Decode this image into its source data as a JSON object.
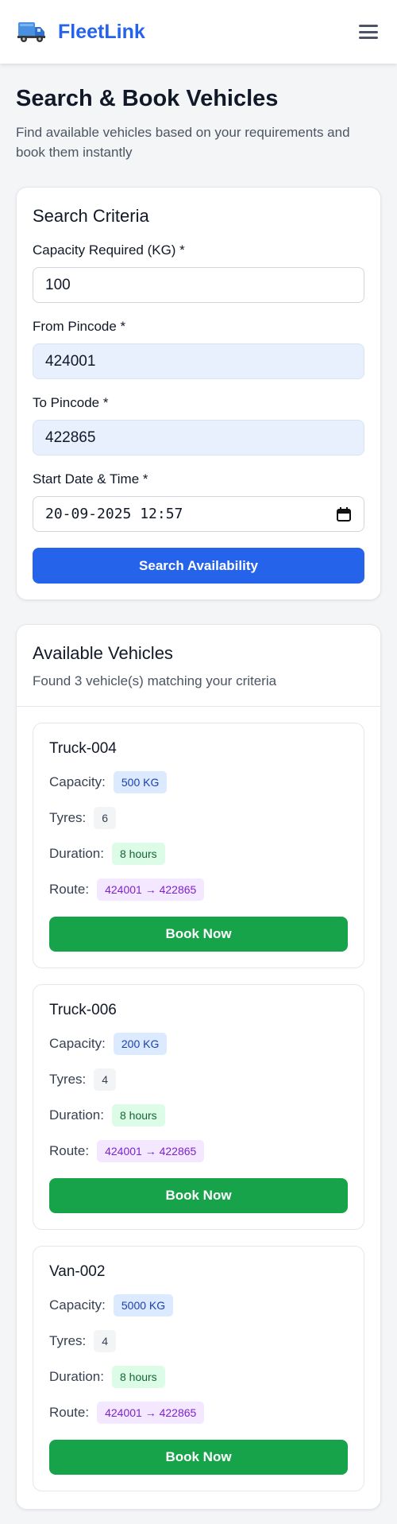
{
  "brand": {
    "name": "FleetLink",
    "icon": "truck-icon",
    "color": "#2563eb"
  },
  "header": {
    "menu_icon": "hamburger-menu-icon"
  },
  "page": {
    "title": "Search & Book Vehicles",
    "subtitle": "Find available vehicles based on your requirements and book them instantly"
  },
  "search": {
    "title": "Search Criteria",
    "capacity_label": "Capacity Required (KG) *",
    "capacity_value": "100",
    "from_label": "From Pincode *",
    "from_value": "424001",
    "to_label": "To Pincode *",
    "to_value": "422865",
    "start_label": "Start Date & Time *",
    "start_value": "20-09-2025 12:57",
    "button_label": "Search Availability"
  },
  "results": {
    "title": "Available Vehicles",
    "summary": "Found 3 vehicle(s) matching your criteria",
    "labels": {
      "capacity": "Capacity:",
      "tyres": "Tyres:",
      "duration": "Duration:",
      "route": "Route:"
    },
    "book_label": "Book Now",
    "vehicles": [
      {
        "name": "Truck-004",
        "capacity": "500 KG",
        "tyres": "6",
        "duration": "8 hours",
        "route": "424001 → 422865"
      },
      {
        "name": "Truck-006",
        "capacity": "200 KG",
        "tyres": "4",
        "duration": "8 hours",
        "route": "424001 → 422865"
      },
      {
        "name": "Van-002",
        "capacity": "5000 KG",
        "tyres": "4",
        "duration": "8 hours",
        "route": "424001 → 422865"
      }
    ]
  },
  "colors": {
    "primary": "#2563eb",
    "success": "#16a34a",
    "filled_input": "#e8f0fe"
  }
}
